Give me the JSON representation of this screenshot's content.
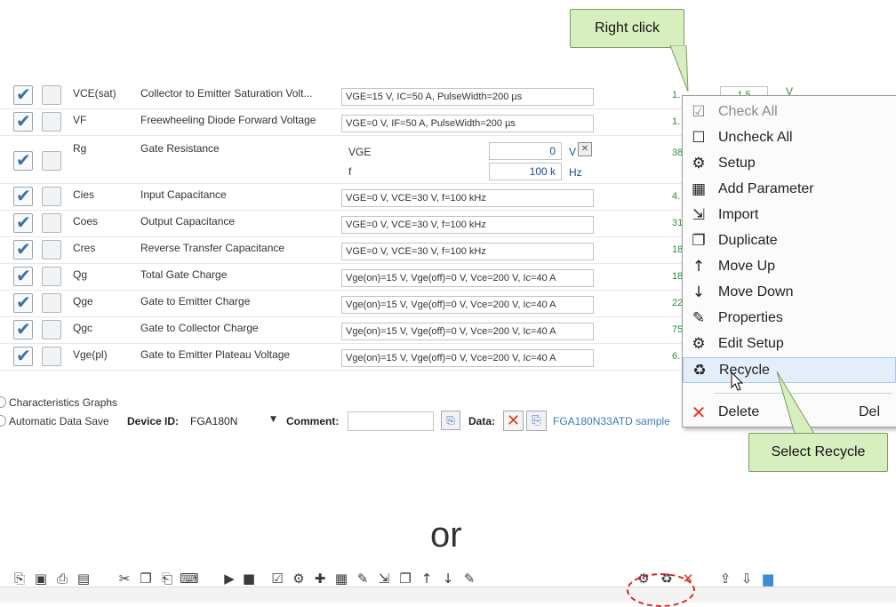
{
  "callouts": {
    "right_click": "Right click",
    "select_recycle": "Select Recycle"
  },
  "or_text": "or",
  "rows": [
    {
      "symbol": "VCE(sat)",
      "desc": "Collector to Emitter Saturation Volt...",
      "cond": "VGE=15 V, IC=50 A, PulseWidth=200 µs",
      "result": "1.",
      "checked": true
    },
    {
      "symbol": "VF",
      "desc": "Freewheeling Diode Forward Voltage",
      "cond": "VGE=0 V, IF=50 A, PulseWidth=200 µs",
      "result": "1.",
      "checked": true
    },
    {
      "symbol": "Rg",
      "desc": "Gate Resistance",
      "cond": "",
      "result": "38",
      "checked": true
    },
    {
      "symbol": "Cies",
      "desc": "Input Capacitance",
      "cond": "VGE=0 V, VCE=30 V, f=100 kHz",
      "result": "4.",
      "checked": true
    },
    {
      "symbol": "Coes",
      "desc": "Output Capacitance",
      "cond": "VGE=0 V, VCE=30 V, f=100 kHz",
      "result": "31",
      "checked": true
    },
    {
      "symbol": "Cres",
      "desc": "Reverse Transfer Capacitance",
      "cond": "VGE=0 V, VCE=30 V, f=100 kHz",
      "result": "18",
      "checked": true
    },
    {
      "symbol": "Qg",
      "desc": "Total Gate Charge",
      "cond": "Vge(on)=15 V, Vge(off)=0 V, Vce=200 V, Ic=40 A",
      "result": "18",
      "checked": true
    },
    {
      "symbol": "Qge",
      "desc": "Gate to Emitter Charge",
      "cond": "Vge(on)=15 V, Vge(off)=0 V, Vce=200 V, Ic=40 A",
      "result": "22",
      "checked": true
    },
    {
      "symbol": "Qgc",
      "desc": "Gate to Collector Charge",
      "cond": "Vge(on)=15 V, Vge(off)=0 V, Vce=200 V, Ic=40 A",
      "result": "75",
      "checked": true
    },
    {
      "symbol": "Vge(pl)",
      "desc": "Gate to Emitter Plateau Voltage",
      "cond": "Vge(on)=15 V, Vge(off)=0 V, Vce=200 V, Ic=40 A",
      "result": "6.",
      "checked": true
    }
  ],
  "row0_extra": {
    "result_box": "1.5",
    "unit": "V"
  },
  "rg_params": {
    "vge_label": "VGE",
    "vge_value": "0",
    "vge_unit": "V",
    "f_label": "f",
    "f_value": "100 k",
    "f_unit": "Hz"
  },
  "footer": {
    "char_graphs": "Characteristics Graphs",
    "auto_save": "Automatic Data Save",
    "device_id_label": "Device ID:",
    "device_id_value": "FGA180N",
    "comment_label": "Comment:",
    "data_label": "Data:",
    "data_file": "FGA180N33ATD sample"
  },
  "context_menu": [
    {
      "label": "Check All",
      "icon": "check-all-icon",
      "glyph": "☑",
      "disabled": true
    },
    {
      "label": "Uncheck All",
      "icon": "uncheck-all-icon",
      "glyph": "☐",
      "disabled": false
    },
    {
      "label": "Setup",
      "icon": "gear-icon",
      "glyph": "⚙",
      "disabled": false
    },
    {
      "label": "Add Parameter",
      "icon": "add-parameter-icon",
      "glyph": "▦",
      "disabled": false
    },
    {
      "label": "Import",
      "icon": "import-icon",
      "glyph": "⇲",
      "disabled": false
    },
    {
      "label": "Duplicate",
      "icon": "duplicate-icon",
      "glyph": "❐",
      "disabled": false
    },
    {
      "label": "Move Up",
      "icon": "arrow-up-icon",
      "glyph": "↑",
      "disabled": false
    },
    {
      "label": "Move Down",
      "icon": "arrow-down-icon",
      "glyph": "↓",
      "disabled": false
    },
    {
      "label": "Properties",
      "icon": "wrench-icon",
      "glyph": "✎",
      "disabled": false
    },
    {
      "label": "Edit Setup",
      "icon": "edit-setup-icon",
      "glyph": "⚙",
      "disabled": false
    },
    {
      "label": "Recycle",
      "icon": "recycle-icon",
      "glyph": "♻",
      "disabled": false,
      "highlighted": true
    }
  ],
  "delete_item": {
    "label": "Delete",
    "shortcut": "Del",
    "icon": "delete-icon",
    "glyph": "✕"
  },
  "toolbar": [
    {
      "name": "open-icon",
      "glyph": "⎘"
    },
    {
      "name": "save-icon",
      "glyph": "▣"
    },
    {
      "name": "print-icon",
      "glyph": "⎙"
    },
    {
      "name": "close-file-icon",
      "glyph": "▤"
    },
    {
      "name": "cut-icon",
      "glyph": "✂"
    },
    {
      "name": "copy-icon",
      "glyph": "❐"
    },
    {
      "name": "paste-icon",
      "glyph": "⎗"
    },
    {
      "name": "keyboard-icon",
      "glyph": "⌨"
    },
    {
      "name": "run-icon",
      "glyph": "▶"
    },
    {
      "name": "stop-icon",
      "glyph": "■"
    },
    {
      "name": "check-all-icon",
      "glyph": "☑"
    },
    {
      "name": "setup-icon",
      "glyph": "⚙"
    },
    {
      "name": "max-icon",
      "glyph": "✚"
    },
    {
      "name": "add-parameter-icon",
      "glyph": "▦"
    },
    {
      "name": "add-icon",
      "glyph": "✎"
    },
    {
      "name": "import-icon",
      "glyph": "⇲"
    },
    {
      "name": "duplicate-icon",
      "glyph": "❐"
    },
    {
      "name": "move-up-icon",
      "glyph": "↑"
    },
    {
      "name": "move-down-icon",
      "glyph": "↓"
    },
    {
      "name": "properties-icon",
      "glyph": "✎"
    },
    {
      "name": "edit-setup-icon",
      "glyph": "⚙"
    },
    {
      "name": "recycle-icon",
      "glyph": "♻"
    },
    {
      "name": "delete-icon",
      "glyph": "✕"
    },
    {
      "name": "export-icon",
      "glyph": "⇪"
    },
    {
      "name": "import-data-icon",
      "glyph": "⇩"
    },
    {
      "name": "graph-icon",
      "glyph": "▆"
    }
  ],
  "colors": {
    "callout_bg": "#d7efbf",
    "check_blue": "#3d6ea8",
    "result_green": "#2a8f3a",
    "delete_red": "#d9391f",
    "highlight_ring": "#e0201b"
  }
}
